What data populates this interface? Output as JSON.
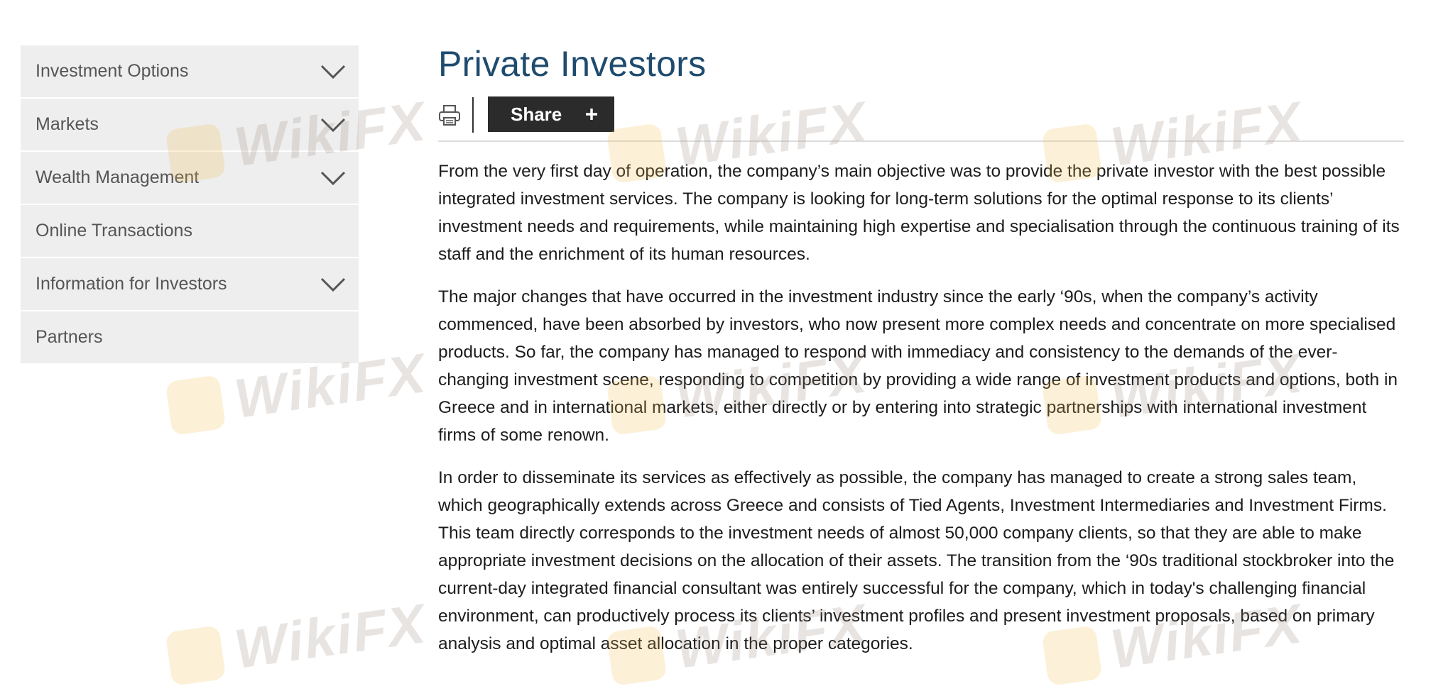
{
  "sidebar": {
    "items": [
      {
        "label": "Investment Options",
        "has_chevron": true
      },
      {
        "label": "Markets",
        "has_chevron": true
      },
      {
        "label": "Wealth Management",
        "has_chevron": true
      },
      {
        "label": "Online Transactions",
        "has_chevron": false
      },
      {
        "label": "Information for Investors",
        "has_chevron": true
      },
      {
        "label": "Partners",
        "has_chevron": false
      }
    ],
    "icons": {
      "chevron": "chevron-down-icon"
    }
  },
  "main": {
    "title": "Private Investors",
    "toolbar": {
      "print_icon": "printer-icon",
      "share_label": "Share",
      "share_icon": "plus-icon"
    },
    "paragraphs": [
      "From the very first day of operation, the company’s main objective was to provide the private investor with the best possible integrated investment services. The company is looking for long-term solutions for the optimal response to its clients’ investment needs and requirements, while maintaining high expertise and specialisation through the continuous training of its staff and the enrichment of its human resources.",
      "The major changes that have occurred in the investment industry since the early ‘90s, when the company’s activity commenced, have been absorbed by investors, who now present more complex needs and concentrate on more specialised products. So far, the company has managed to respond with immediacy and consistency to the demands of the ever-changing investment scene, responding to competition by providing a wide range of investment products and options, both in Greece and in international markets, either directly or by entering into strategic partnerships with international investment firms of some renown.",
      "In order to disseminate its services as effectively as possible, the company has managed to create a strong sales team, which geographically extends across Greece and consists of Tied Agents, Investment Intermediaries and Investment Firms. This team directly corresponds to the investment needs of almost 50,000 company clients, so that they are able to make appropriate investment decisions on the allocation of their assets. The transition from the ‘90s traditional stockbroker into the current-day integrated financial consultant was entirely successful for the company, which in today's challenging financial environment, can productively process its clients’ investment profiles and present investment proposals, based on primary analysis and optimal asset allocation in the proper categories."
    ]
  },
  "watermark": {
    "text": "WikiFX"
  },
  "colors": {
    "title": "#1e4b6e",
    "sidebar_bg": "#eeeeee",
    "sidebar_text": "#555555",
    "share_bg": "#2b2b2b",
    "body_text": "#1c1c1c"
  }
}
